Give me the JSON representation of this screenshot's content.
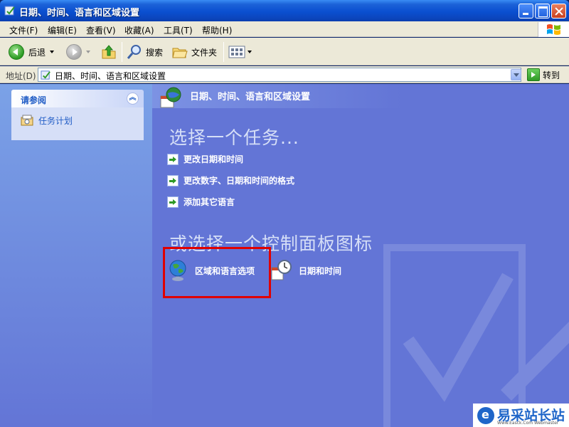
{
  "window": {
    "title": "日期、时间、语言和区域设置"
  },
  "menu": {
    "items": [
      "文件(F)",
      "编辑(E)",
      "查看(V)",
      "收藏(A)",
      "工具(T)",
      "帮助(H)"
    ]
  },
  "toolbar": {
    "back_label": "后退",
    "search_label": "搜索",
    "folders_label": "文件夹"
  },
  "address": {
    "label": "地址(D)",
    "value": "日期、时间、语言和区域设置",
    "go_label": "转到"
  },
  "sidebar": {
    "see_also_title": "请参阅",
    "items": [
      {
        "label": "任务计划",
        "icon": "scheduled-tasks-icon"
      }
    ]
  },
  "main": {
    "header_title": "日期、时间、语言和区域设置",
    "tasks_title": "选择一个任务...",
    "tasks": [
      {
        "label": "更改日期和时间"
      },
      {
        "label": "更改数字、日期和时间的格式"
      },
      {
        "label": "添加其它语言"
      }
    ],
    "icons_title": "或选择一个控制面板图标",
    "control_panel_icons": [
      {
        "label": "区域和语言选项",
        "icon": "globe-icon"
      },
      {
        "label": "日期和时间",
        "icon": "clock-calendar-icon"
      }
    ],
    "highlight_color": "#e00000"
  },
  "badge": {
    "text": "易采站长站",
    "sub": "Www.Easck.Com Webmaster"
  },
  "colors": {
    "title_bar": "#0a4fd0",
    "left_pane": "#7ba2e7",
    "main_pane": "#6375d6",
    "link_blue": "#215dc6"
  }
}
